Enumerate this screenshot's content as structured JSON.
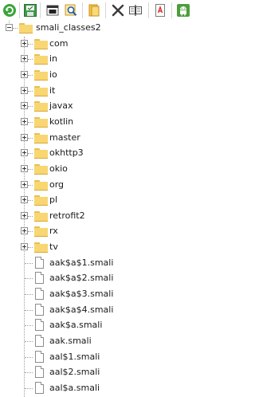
{
  "toolbar": {
    "buttons": [
      {
        "name": "refresh-button",
        "icon": "refresh-icon"
      },
      {
        "name": "save-button",
        "icon": "save-icon"
      },
      {
        "name": "view-button",
        "icon": "window-icon"
      },
      {
        "name": "search-button",
        "icon": "search-icon"
      },
      {
        "name": "open-folder-button",
        "icon": "folder-open-icon"
      },
      {
        "name": "delete-button",
        "icon": "close-icon"
      },
      {
        "name": "compare-button",
        "icon": "compare-icon"
      },
      {
        "name": "pdf-button",
        "icon": "pdf-icon"
      },
      {
        "name": "android-button",
        "icon": "android-icon"
      }
    ]
  },
  "tree": {
    "root": {
      "label": "smali_classes2",
      "expanded": true
    },
    "folders": [
      {
        "label": "com"
      },
      {
        "label": "in"
      },
      {
        "label": "io"
      },
      {
        "label": "it"
      },
      {
        "label": "javax"
      },
      {
        "label": "kotlin"
      },
      {
        "label": "master"
      },
      {
        "label": "okhttp3"
      },
      {
        "label": "okio"
      },
      {
        "label": "org"
      },
      {
        "label": "pl"
      },
      {
        "label": "retrofit2"
      },
      {
        "label": "rx"
      },
      {
        "label": "tv"
      }
    ],
    "files": [
      {
        "label": "aak$a$1.smali"
      },
      {
        "label": "aak$a$2.smali"
      },
      {
        "label": "aak$a$3.smali"
      },
      {
        "label": "aak$a$4.smali"
      },
      {
        "label": "aak$a.smali"
      },
      {
        "label": "aak.smali"
      },
      {
        "label": "aal$1.smali"
      },
      {
        "label": "aal$2.smali"
      },
      {
        "label": "aal$a.smali"
      }
    ]
  }
}
